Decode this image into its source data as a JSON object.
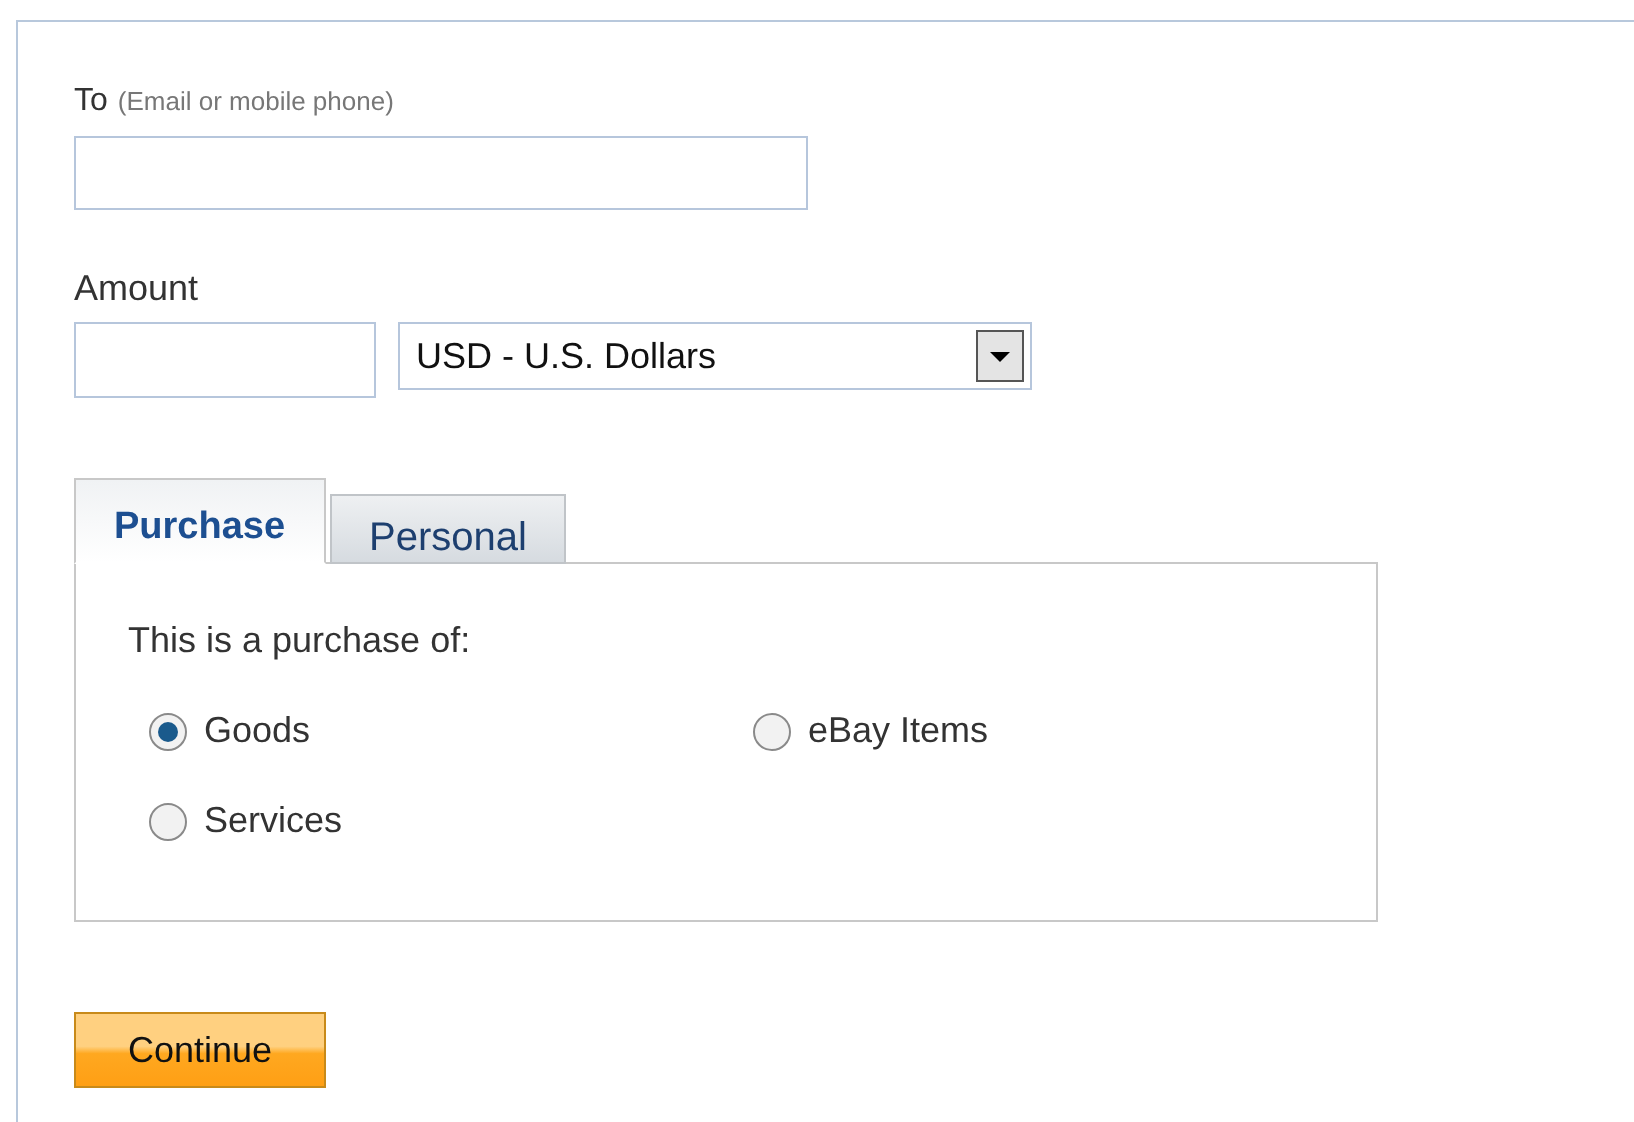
{
  "to_field": {
    "label": "To",
    "hint": "(Email or mobile phone)"
  },
  "amount_field": {
    "label": "Amount"
  },
  "currency_select": {
    "value": "USD - U.S. Dollars"
  },
  "tabs": [
    {
      "label": "Purchase",
      "selected": true
    },
    {
      "label": "Personal",
      "selected": false
    }
  ],
  "purchase_panel": {
    "prompt": "This is a purchase of:",
    "options": [
      {
        "label": "Goods",
        "selected": true
      },
      {
        "label": "eBay Items",
        "selected": false
      },
      {
        "label": "Services",
        "selected": false
      }
    ]
  },
  "continue_button": {
    "label": "Continue"
  }
}
